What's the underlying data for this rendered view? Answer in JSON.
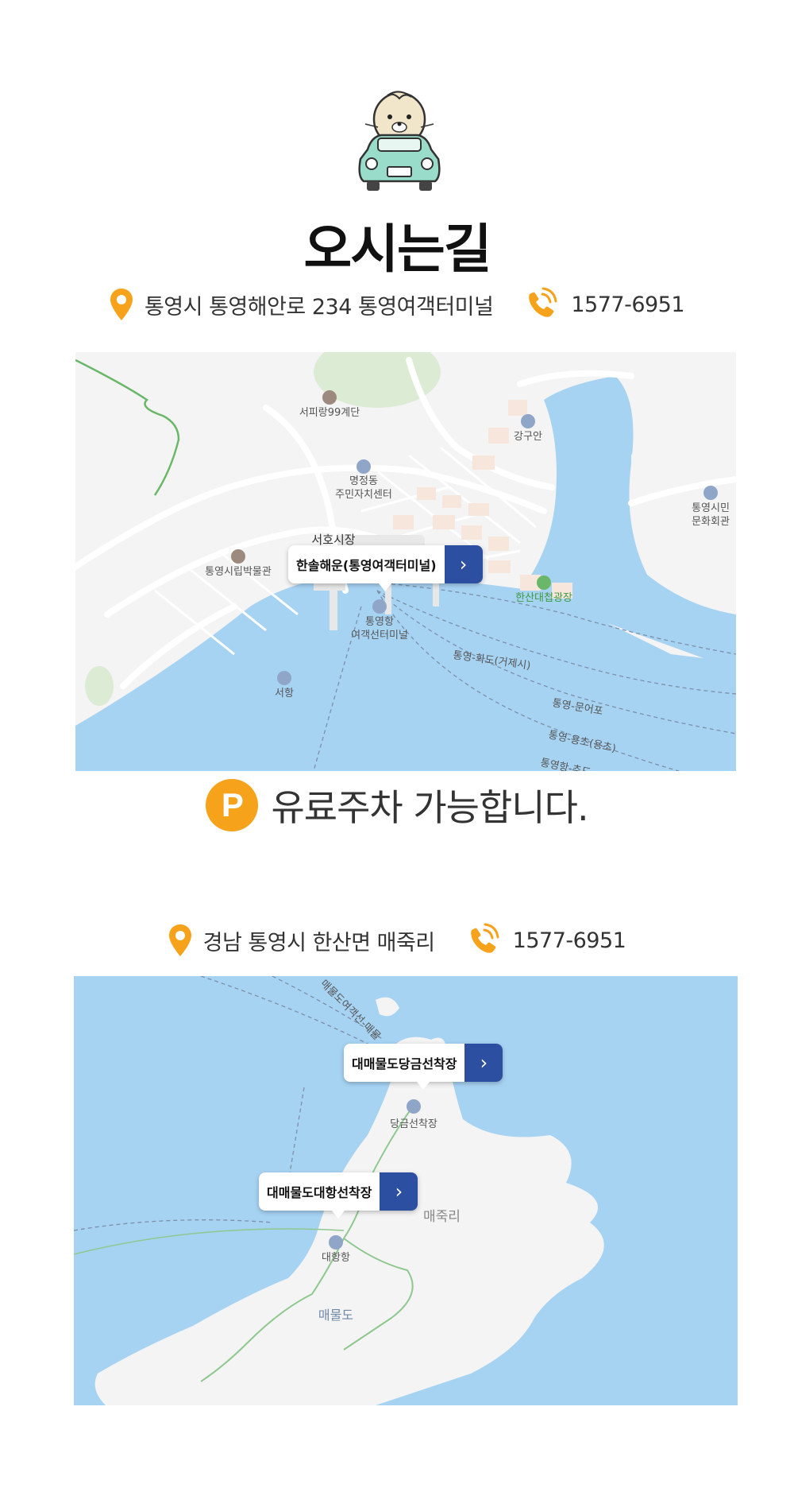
{
  "header": {
    "title": "오시는길"
  },
  "location1": {
    "address": "통영시 통영해안로 234 통영여객터미널",
    "phone": "1577-6951",
    "map": {
      "callout": "한솔해운(통영여객터미널)",
      "labels": {
        "seopirang": "서피랑99계단",
        "ganguan": "강구안",
        "myeongjeong1": "명정동",
        "myeongjeong2": "주민자치센터",
        "seohomarket": "서호시장",
        "museum": "통영시립박물관",
        "cultural1": "통영시민",
        "cultural2": "문화회관",
        "hansan_square": "한산대첩광장",
        "terminal1": "통영항",
        "terminal2": "여객선터미널",
        "seohang": "서항",
        "route1": "통영-화도(거제시)",
        "route2": "통영-문어포",
        "route3": "통영-용초(용초)",
        "route4": "통영항-추도"
      }
    }
  },
  "parking": {
    "badge": "P",
    "text": "유료주차 가능합니다."
  },
  "location2": {
    "address": "경남 통영시 한산면 매죽리",
    "phone": "1577-6951",
    "map": {
      "callout_top": "대매물도당금선착장",
      "callout_left": "대매물도대항선착장",
      "labels": {
        "route": "매물도여객선-매물",
        "danggeum": "당금선착장",
        "maejukri": "매죽리",
        "daehang": "대항항",
        "maemuldo": "매물도"
      }
    }
  },
  "colors": {
    "accent_orange": "#f7a21b",
    "callout_blue": "#2c4fa1",
    "sea": "#a7d3f3",
    "land": "#f4f4f4"
  },
  "icons": [
    "driver-car-illustration",
    "location-pin-icon",
    "phone-icon",
    "chevron-right-icon",
    "parking-icon"
  ]
}
